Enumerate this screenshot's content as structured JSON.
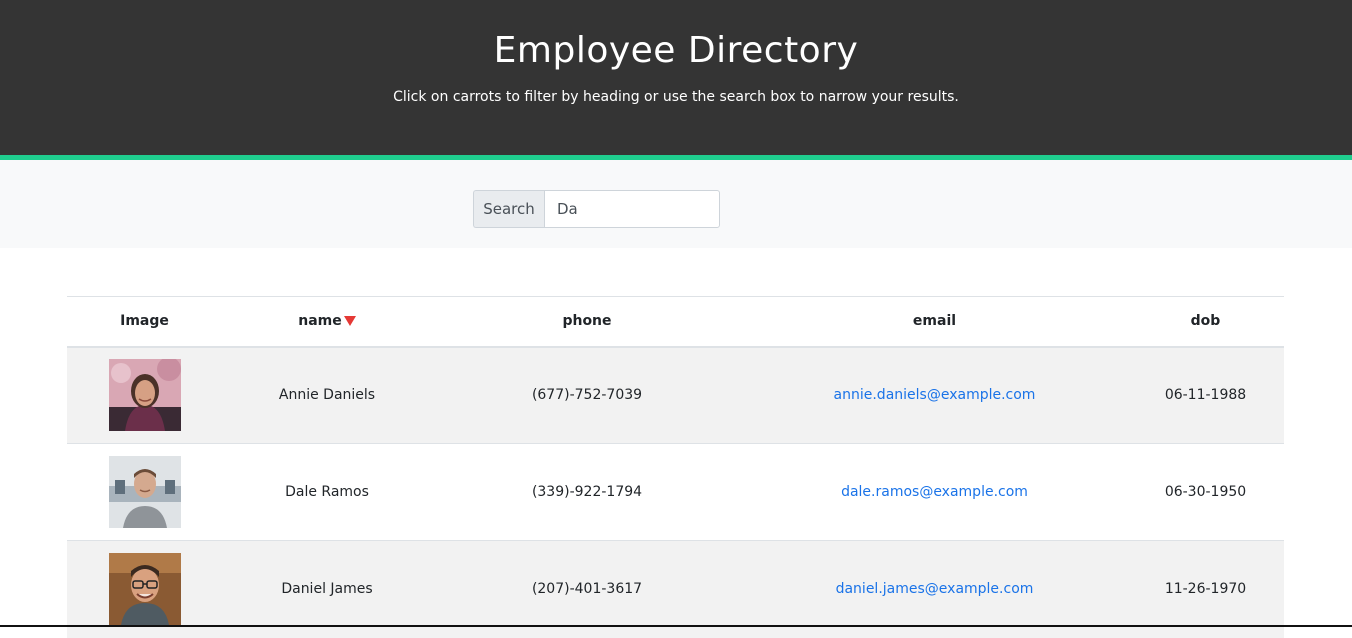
{
  "header": {
    "title": "Employee Directory",
    "subtitle": "Click on carrots to filter by heading or use the search box to narrow your results."
  },
  "colors": {
    "header_bg": "#343434",
    "accent": "#1fcd8e",
    "sort_caret": "#e53935",
    "link": "#1a73e8"
  },
  "search": {
    "label": "Search",
    "value": "Da",
    "placeholder": ""
  },
  "table": {
    "columns": [
      "Image",
      "name",
      "phone",
      "email",
      "dob"
    ],
    "sorted_column": "name",
    "sort_direction": "descending",
    "rows": [
      {
        "name": "Annie Daniels",
        "phone": "(677)-752-7039",
        "email": "annie.daniels@example.com",
        "dob": "06-11-1988"
      },
      {
        "name": "Dale Ramos",
        "phone": "(339)-922-1794",
        "email": "dale.ramos@example.com",
        "dob": "06-30-1950"
      },
      {
        "name": "Daniel James",
        "phone": "(207)-401-3617",
        "email": "daniel.james@example.com",
        "dob": "11-26-1970"
      }
    ]
  }
}
